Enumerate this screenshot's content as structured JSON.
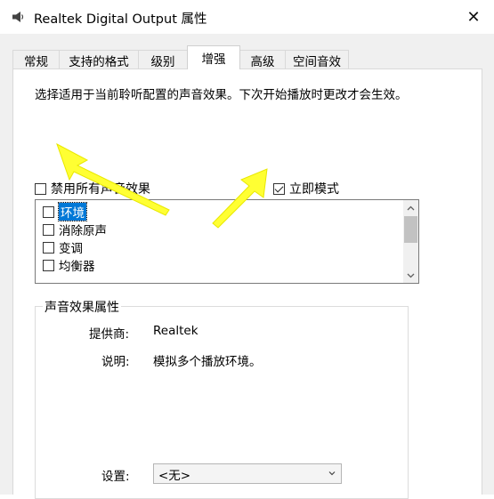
{
  "window": {
    "title": "Realtek Digital Output 属性",
    "close_glyph": "✕"
  },
  "tabs": [
    {
      "label": "常规",
      "active": false
    },
    {
      "label": "支持的格式",
      "active": false
    },
    {
      "label": "级别",
      "active": false
    },
    {
      "label": "增强",
      "active": true
    },
    {
      "label": "高级",
      "active": false
    },
    {
      "label": "空间音效",
      "active": false
    }
  ],
  "enhancement": {
    "description": "选择适用于当前聆听配置的声音效果。下次开始播放时更改才会生效。",
    "disable_all": {
      "label": "禁用所有声音效果",
      "checked": false
    },
    "immediate_mode": {
      "label": "立即模式",
      "checked": true
    },
    "effects": [
      {
        "label": "环境",
        "checked": false,
        "selected": true
      },
      {
        "label": "消除原声",
        "checked": false,
        "selected": false
      },
      {
        "label": "变调",
        "checked": false,
        "selected": false
      },
      {
        "label": "均衡器",
        "checked": false,
        "selected": false
      }
    ],
    "properties": {
      "group_title": "声音效果属性",
      "provider_label": "提供商:",
      "provider_value": "Realtek",
      "description_label": "说明:",
      "description_value": "模拟多个播放环境。",
      "setting_label": "设置:",
      "setting_value": "<无>"
    }
  },
  "colors": {
    "annotation_arrow": "#ffff33",
    "selection": "#0078d7"
  },
  "icons": {
    "title": "speaker-icon",
    "scroll_up": "chevron-up-icon",
    "scroll_down": "chevron-down-icon",
    "dropdown": "chevron-down-icon"
  }
}
